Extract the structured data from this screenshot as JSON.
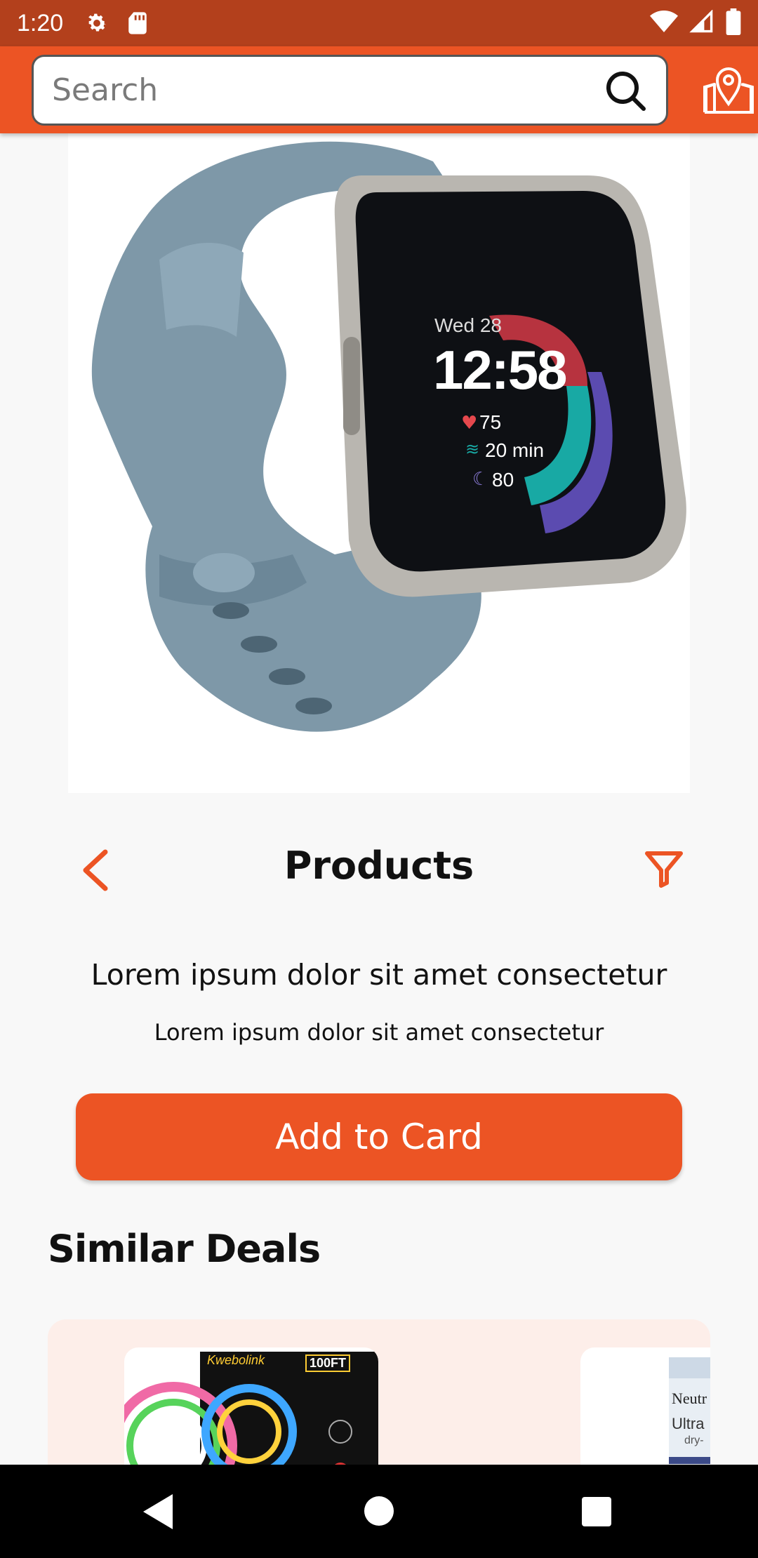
{
  "status_bar": {
    "time": "1:20",
    "icons": [
      "gear-icon",
      "sd-card-icon",
      "wifi-icon",
      "signal-icon",
      "battery-icon"
    ]
  },
  "app_bar": {
    "search_placeholder": "Search",
    "search_value": "",
    "icons": [
      "search-icon",
      "location-pin-icon"
    ],
    "accent_color": "#ec5424"
  },
  "product_image": {
    "watch_screen": {
      "date": "Wed 28",
      "time": "12:58",
      "heart_rate": "75",
      "active_minutes": "20 min",
      "sleep_score": "80"
    }
  },
  "header": {
    "title": "Products",
    "back_icon": "chevron-left-icon",
    "filter_icon": "filter-icon"
  },
  "description": {
    "line1": "Lorem ipsum dolor sit amet consectetur",
    "line2": "Lorem ipsum dolor sit amet consectetur"
  },
  "add_button": {
    "label": "Add to Card"
  },
  "similar_deals": {
    "title": "Similar Deals",
    "items": [
      {
        "box_label": "100FT",
        "brand": "Kwebolink"
      },
      {
        "brand": "Neutr",
        "text": "Ultra",
        "sub": "dry-"
      }
    ]
  },
  "nav_bar": {
    "icons": [
      "back-triangle-icon",
      "home-circle-icon",
      "recents-square-icon"
    ]
  }
}
